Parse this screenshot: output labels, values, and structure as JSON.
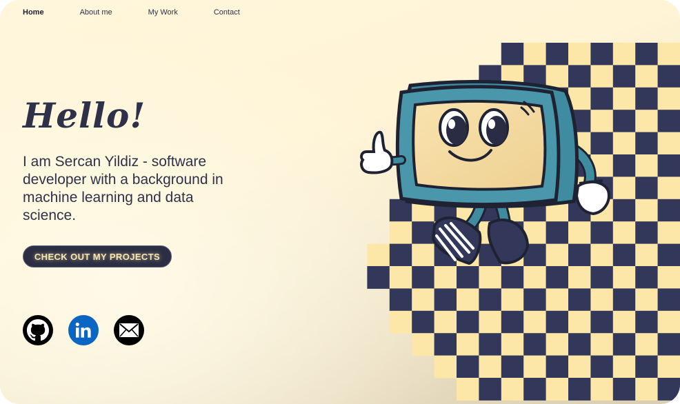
{
  "nav": {
    "items": [
      {
        "label": "Home",
        "active": true
      },
      {
        "label": "About me",
        "active": false
      },
      {
        "label": "My Work",
        "active": false
      },
      {
        "label": "Contact",
        "active": false
      }
    ]
  },
  "hero": {
    "greeting": "Hello!",
    "intro": "I am Sercan Yildiz - software developer with a background in machine learning and data science.",
    "cta_label": "CHECK OUT MY PROJECTS"
  },
  "socials": [
    {
      "name": "github-icon",
      "color": "#000000"
    },
    {
      "name": "linkedin-icon",
      "color": "#0a66c2"
    },
    {
      "name": "mail-icon",
      "color": "#000000"
    }
  ],
  "colors": {
    "dark": "#2c2f44",
    "checker_dark": "#33385a",
    "checker_light": "#fde7a8",
    "accent": "#f7e7b2"
  }
}
